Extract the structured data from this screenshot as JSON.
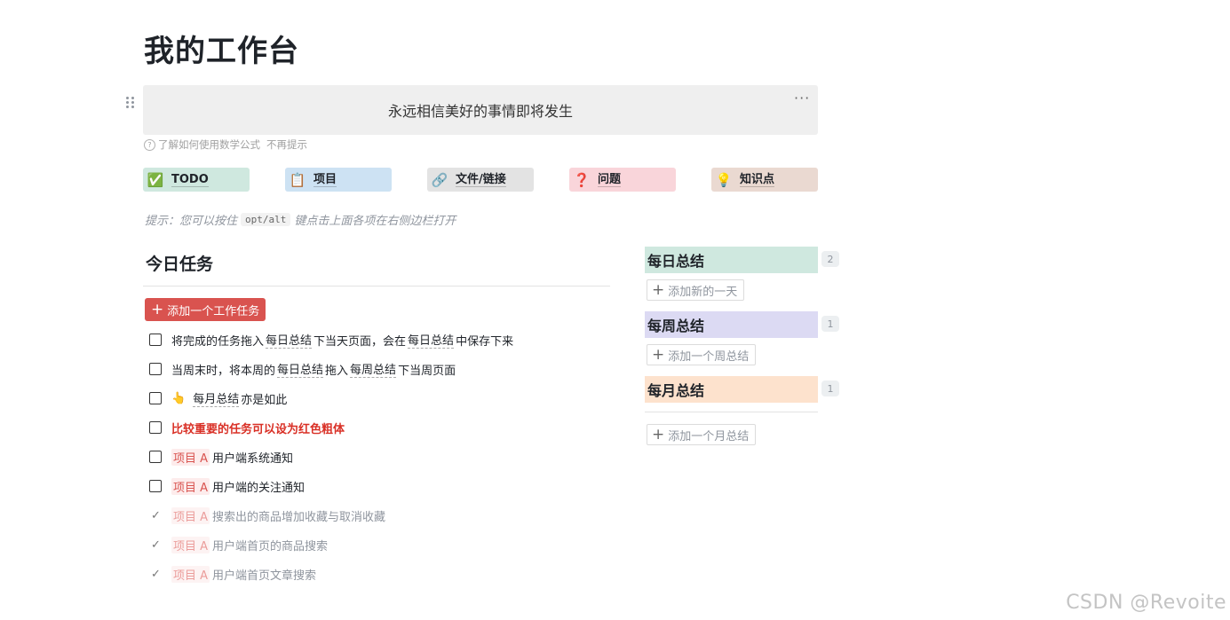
{
  "page": {
    "title": "我的工作台"
  },
  "quote": {
    "text": "永远相信美好的事情即将发生",
    "more_icon": "···"
  },
  "formula_hint": {
    "icon": "?",
    "text": "了解如何使用数学公式",
    "dismiss": "不再提示"
  },
  "nav_tiles": [
    {
      "label": "TODO",
      "icon": "✅",
      "icon_name": "check-box-icon",
      "bg": "#cfe8df"
    },
    {
      "label": "项目",
      "icon": "📋",
      "icon_name": "clipboard-icon",
      "bg": "#cde2f3"
    },
    {
      "label": "文件/链接",
      "icon": "🔗",
      "icon_name": "link-icon",
      "bg": "#e3e3e3"
    },
    {
      "label": "问题",
      "icon": "❓",
      "icon_name": "question-icon",
      "bg": "#f9d5da"
    },
    {
      "label": "知识点",
      "icon": "💡",
      "icon_name": "lightbulb-icon",
      "bg": "#ead9d1"
    }
  ],
  "tip": {
    "prefix": "提示：您可以按住",
    "key": "opt/alt",
    "suffix": "键点击上面各项在右侧边栏打开"
  },
  "today": {
    "heading": "今日任务",
    "add_button": "添加一个工作任务",
    "tasks": {
      "t1": {
        "a": "将完成的任务拖入",
        "m1": "每日总结",
        "b": "下当天页面，会在",
        "m2": "每日总结",
        "c": "中保存下来"
      },
      "t2": {
        "a": "当周末时，将本周的",
        "m1": "每日总结",
        "b": "拖入",
        "m2": "每周总结",
        "c": "下当周页面"
      },
      "t3": {
        "hand": "👆",
        "m1": "每月总结",
        "c": "亦是如此"
      },
      "t4": {
        "text": "比较重要的任务可以设为红色粗体"
      },
      "t5": {
        "tag": "项目 A",
        "text": "用户端系统通知"
      },
      "t6": {
        "tag": "项目 A",
        "text": "用户端的关注通知"
      },
      "t7": {
        "tag": "项目 A",
        "text": "搜索出的商品增加收藏与取消收藏",
        "check": "✓"
      },
      "t8": {
        "tag": "项目 A",
        "text": "用户端首页的商品搜索",
        "check": "✓"
      },
      "t9": {
        "tag": "项目 A",
        "text": "用户端首页文章搜索",
        "check": "✓"
      }
    }
  },
  "summaries": {
    "daily": {
      "title": "每日总结",
      "count": "2",
      "add_label": "添加新的一天",
      "bg": "#cfe8df"
    },
    "weekly": {
      "title": "每周总结",
      "count": "1",
      "add_label": "添加一个周总结",
      "bg": "#dcdaf3"
    },
    "monthly": {
      "title": "每月总结",
      "count": "1",
      "add_label": "添加一个月总结",
      "bg": "#fde2cd"
    }
  },
  "watermark": "CSDN @Revoite"
}
